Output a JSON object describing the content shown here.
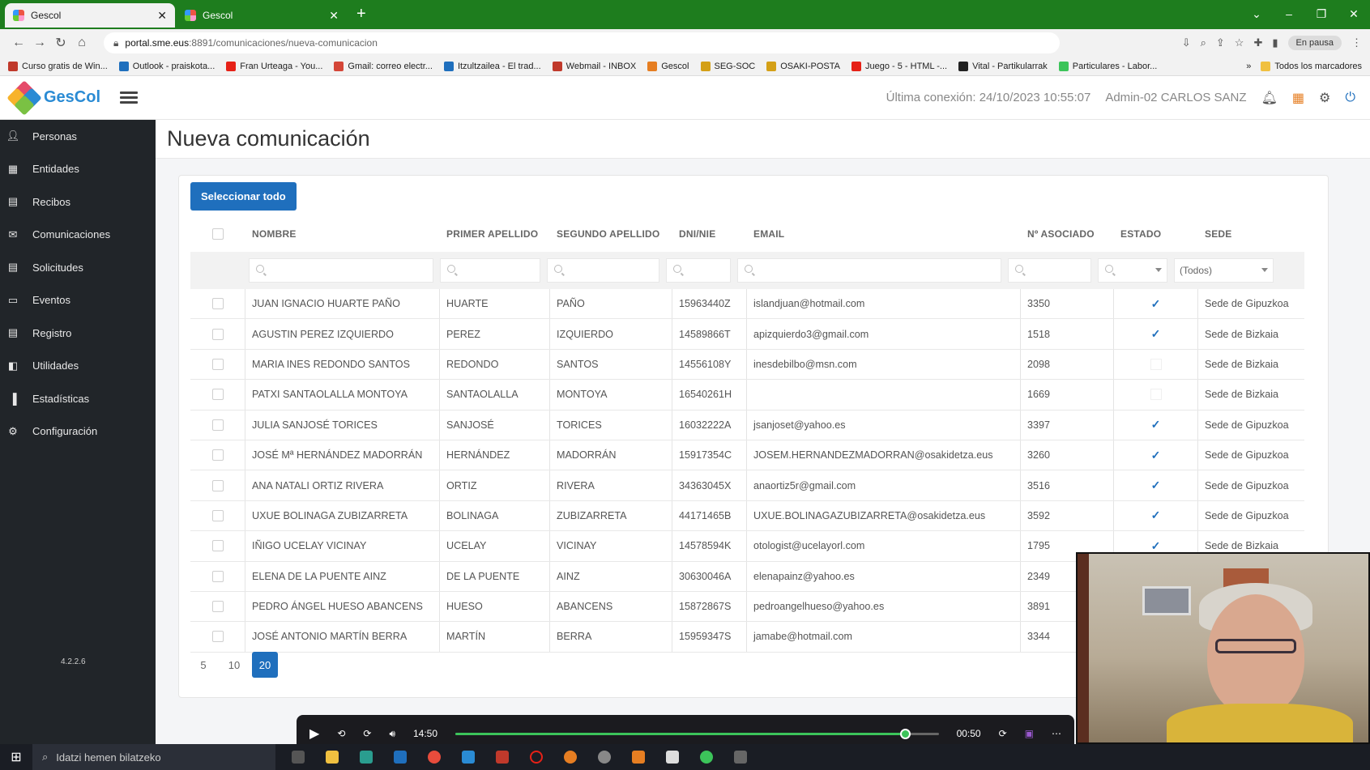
{
  "browser": {
    "tabs": [
      {
        "label": "Gescol",
        "close": "✕"
      },
      {
        "label": "Gescol",
        "close": "✕"
      }
    ],
    "new_tab": "+",
    "url_host": "portal.sme.eus",
    "url_path": ":8891/comunicaciones/nueva-comunicacion",
    "profile_status": "En pausa",
    "bookmarks": [
      {
        "label": "Curso gratis de Win...",
        "color": "#c0392b"
      },
      {
        "label": "Outlook - praiskota...",
        "color": "#1f6fbd"
      },
      {
        "label": "Fran Urteaga - You...",
        "color": "#e62117"
      },
      {
        "label": "Gmail: correo electr...",
        "color": "#d44638"
      },
      {
        "label": "Itzultzailea - El trad...",
        "color": "#1f6fbd"
      },
      {
        "label": "Webmail - INBOX",
        "color": "#c0392b"
      },
      {
        "label": "Gescol",
        "color": "#e67e22"
      },
      {
        "label": "SEG-SOC",
        "color": "#d4a017"
      },
      {
        "label": "OSAKI-POSTA",
        "color": "#d4a017"
      },
      {
        "label": "Juego - 5 - HTML -...",
        "color": "#e62117"
      },
      {
        "label": "Vital - Partikularrak",
        "color": "#222"
      },
      {
        "label": "Particulares - Labor...",
        "color": "#3cc45a"
      }
    ],
    "bookmarks_more": "»",
    "all_bookmarks": "Todos los marcadores"
  },
  "header": {
    "logo_text": "GesCol",
    "last_connection": "Última conexión: 24/10/2023 10:55:07",
    "user": "Admin-02 CARLOS SANZ"
  },
  "sidebar": {
    "items": [
      {
        "label": "Personas",
        "icon": "user-icon"
      },
      {
        "label": "Entidades",
        "icon": "building-icon"
      },
      {
        "label": "Recibos",
        "icon": "receipt-icon"
      },
      {
        "label": "Comunicaciones",
        "icon": "envelope-icon"
      },
      {
        "label": "Solicitudes",
        "icon": "file-icon"
      },
      {
        "label": "Eventos",
        "icon": "calendar-icon"
      },
      {
        "label": "Registro",
        "icon": "clipboard-icon"
      },
      {
        "label": "Utilidades",
        "icon": "grid-icon"
      },
      {
        "label": "Estadísticas",
        "icon": "bar-chart-icon"
      },
      {
        "label": "Configuración",
        "icon": "gear-icon"
      }
    ],
    "version": "4.2.2.6"
  },
  "page": {
    "title": "Nueva comunicación",
    "select_all": "Seleccionar todo"
  },
  "table": {
    "columns": [
      "NOMBRE",
      "PRIMER APELLIDO",
      "SEGUNDO APELLIDO",
      "DNI/NIE",
      "EMAIL",
      "Nº ASOCIADO",
      "ESTADO",
      "SEDE"
    ],
    "sede_filter": "(Todos)",
    "rows": [
      {
        "nombre": "JUAN IGNACIO HUARTE PAÑO",
        "ap1": "HUARTE",
        "ap2": "PAÑO",
        "dni": "15963440Z",
        "email": "islandjuan@hotmail.com",
        "num": "3350",
        "estado": true,
        "sede": "Sede de Gipuzkoa"
      },
      {
        "nombre": "AGUSTIN PEREZ IZQUIERDO",
        "ap1": "PEREZ",
        "ap2": "IZQUIERDO",
        "dni": "14589866T",
        "email": "apizquierdo3@gmail.com",
        "num": "1518",
        "estado": true,
        "sede": "Sede de Bizkaia"
      },
      {
        "nombre": "MARIA INES REDONDO SANTOS",
        "ap1": "REDONDO",
        "ap2": "SANTOS",
        "dni": "14556108Y",
        "email": "inesdebilbo@msn.com",
        "num": "2098",
        "estado": false,
        "sede": "Sede de Bizkaia"
      },
      {
        "nombre": "PATXI SANTAOLALLA MONTOYA",
        "ap1": "SANTAOLALLA",
        "ap2": "MONTOYA",
        "dni": "16540261H",
        "email": "",
        "num": "1669",
        "estado": false,
        "sede": "Sede de Bizkaia"
      },
      {
        "nombre": "JULIA SANJOSÉ TORICES",
        "ap1": "SANJOSÉ",
        "ap2": "TORICES",
        "dni": "16032222A",
        "email": "jsanjoset@yahoo.es",
        "num": "3397",
        "estado": true,
        "sede": "Sede de Gipuzkoa"
      },
      {
        "nombre": "JOSÉ Mª HERNÁNDEZ MADORRÁN",
        "ap1": "HERNÁNDEZ",
        "ap2": "MADORRÁN",
        "dni": "15917354C",
        "email": "JOSEM.HERNANDEZMADORRAN@osakidetza.eus",
        "num": "3260",
        "estado": true,
        "sede": "Sede de Gipuzkoa"
      },
      {
        "nombre": "ANA NATALI ORTIZ RIVERA",
        "ap1": "ORTIZ",
        "ap2": "RIVERA",
        "dni": "34363045X",
        "email": "anaortiz5r@gmail.com",
        "num": "3516",
        "estado": true,
        "sede": "Sede de Gipuzkoa"
      },
      {
        "nombre": "UXUE BOLINAGA ZUBIZARRETA",
        "ap1": "BOLINAGA",
        "ap2": "ZUBIZARRETA",
        "dni": "44171465B",
        "email": "UXUE.BOLINAGAZUBIZARRETA@osakidetza.eus",
        "num": "3592",
        "estado": true,
        "sede": "Sede de Gipuzkoa"
      },
      {
        "nombre": "IÑIGO UCELAY VICINAY",
        "ap1": "UCELAY",
        "ap2": "VICINAY",
        "dni": "14578594K",
        "email": "otologist@ucelayorl.com",
        "num": "1795",
        "estado": true,
        "sede": "Sede de Bizkaia"
      },
      {
        "nombre": "ELENA DE LA PUENTE AINZ",
        "ap1": "DE LA PUENTE",
        "ap2": "AINZ",
        "dni": "30630046A",
        "email": "elenapainz@yahoo.es",
        "num": "2349",
        "estado": null,
        "sede": ""
      },
      {
        "nombre": "PEDRO ÁNGEL HUESO ABANCENS",
        "ap1": "HUESO",
        "ap2": "ABANCENS",
        "dni": "15872867S",
        "email": "pedroangelhueso@yahoo.es",
        "num": "3891",
        "estado": null,
        "sede": ""
      },
      {
        "nombre": "JOSÉ ANTONIO MARTÍN BERRA",
        "ap1": "MARTÍN",
        "ap2": "BERRA",
        "dni": "15959347S",
        "email": "jamabe@hotmail.com",
        "num": "3344",
        "estado": null,
        "sede": ""
      }
    ]
  },
  "pager": {
    "sizes": [
      "5",
      "10",
      "20"
    ],
    "active": "20"
  },
  "player": {
    "current_time": "14:50",
    "remaining": "00:50",
    "progress": 0.93
  },
  "taskbar": {
    "search_placeholder": "Idatzi hemen bilatzeko"
  }
}
